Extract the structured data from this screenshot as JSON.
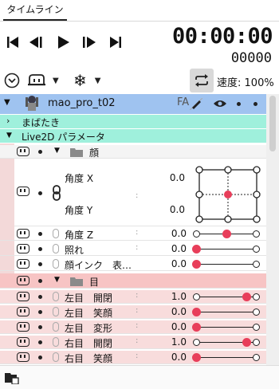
{
  "tab": {
    "label": "タイムライン"
  },
  "transport": {
    "timecode": "00:00:00",
    "frames": "00000"
  },
  "toolbar": {
    "speed_label": "速度:",
    "speed_value": "100%"
  },
  "model": {
    "name": "mao_pro_t02",
    "badge": "FA"
  },
  "groups": {
    "mabataki": "まばたき",
    "live2d": "Live2D パラメータ"
  },
  "folders": {
    "face": "顔",
    "eye": "目"
  },
  "params": {
    "angle_x": {
      "name": "角度 X",
      "value": "0.0"
    },
    "angle_y": {
      "name": "角度 Y",
      "value": "0.0"
    },
    "angle_z": {
      "name": "角度 Z",
      "value": "0.0"
    },
    "tere": {
      "name": "照れ",
      "value": "0.0"
    },
    "ink": {
      "name": "顔インク　表…",
      "value": "0.0"
    },
    "l_open": {
      "name": "左目　開閉",
      "value": "1.0"
    },
    "l_smile": {
      "name": "左目　笑顔",
      "value": "0.0"
    },
    "l_form": {
      "name": "左目　変形",
      "value": "0.0"
    },
    "r_open": {
      "name": "右目　開閉",
      "value": "1.0"
    },
    "r_smile": {
      "name": "右目　笑顔",
      "value": "0.0"
    }
  },
  "colors": {
    "model_row": "#9fc3f0",
    "group_row": "#9ff0dc",
    "eye_folder": "#f7c4c4",
    "accent": "#e83e5a"
  }
}
